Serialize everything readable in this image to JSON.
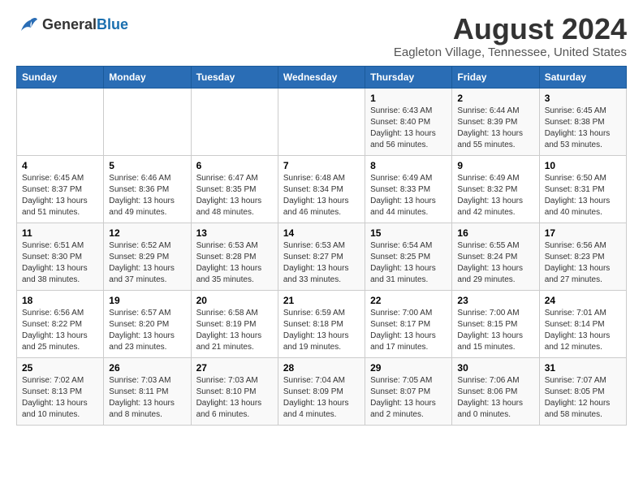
{
  "logo": {
    "general": "General",
    "blue": "Blue"
  },
  "title": "August 2024",
  "subtitle": "Eagleton Village, Tennessee, United States",
  "days_of_week": [
    "Sunday",
    "Monday",
    "Tuesday",
    "Wednesday",
    "Thursday",
    "Friday",
    "Saturday"
  ],
  "weeks": [
    [
      {
        "day": "",
        "sunrise": "",
        "sunset": "",
        "daylight": ""
      },
      {
        "day": "",
        "sunrise": "",
        "sunset": "",
        "daylight": ""
      },
      {
        "day": "",
        "sunrise": "",
        "sunset": "",
        "daylight": ""
      },
      {
        "day": "",
        "sunrise": "",
        "sunset": "",
        "daylight": ""
      },
      {
        "day": "1",
        "sunrise": "Sunrise: 6:43 AM",
        "sunset": "Sunset: 8:40 PM",
        "daylight": "Daylight: 13 hours and 56 minutes."
      },
      {
        "day": "2",
        "sunrise": "Sunrise: 6:44 AM",
        "sunset": "Sunset: 8:39 PM",
        "daylight": "Daylight: 13 hours and 55 minutes."
      },
      {
        "day": "3",
        "sunrise": "Sunrise: 6:45 AM",
        "sunset": "Sunset: 8:38 PM",
        "daylight": "Daylight: 13 hours and 53 minutes."
      }
    ],
    [
      {
        "day": "4",
        "sunrise": "Sunrise: 6:45 AM",
        "sunset": "Sunset: 8:37 PM",
        "daylight": "Daylight: 13 hours and 51 minutes."
      },
      {
        "day": "5",
        "sunrise": "Sunrise: 6:46 AM",
        "sunset": "Sunset: 8:36 PM",
        "daylight": "Daylight: 13 hours and 49 minutes."
      },
      {
        "day": "6",
        "sunrise": "Sunrise: 6:47 AM",
        "sunset": "Sunset: 8:35 PM",
        "daylight": "Daylight: 13 hours and 48 minutes."
      },
      {
        "day": "7",
        "sunrise": "Sunrise: 6:48 AM",
        "sunset": "Sunset: 8:34 PM",
        "daylight": "Daylight: 13 hours and 46 minutes."
      },
      {
        "day": "8",
        "sunrise": "Sunrise: 6:49 AM",
        "sunset": "Sunset: 8:33 PM",
        "daylight": "Daylight: 13 hours and 44 minutes."
      },
      {
        "day": "9",
        "sunrise": "Sunrise: 6:49 AM",
        "sunset": "Sunset: 8:32 PM",
        "daylight": "Daylight: 13 hours and 42 minutes."
      },
      {
        "day": "10",
        "sunrise": "Sunrise: 6:50 AM",
        "sunset": "Sunset: 8:31 PM",
        "daylight": "Daylight: 13 hours and 40 minutes."
      }
    ],
    [
      {
        "day": "11",
        "sunrise": "Sunrise: 6:51 AM",
        "sunset": "Sunset: 8:30 PM",
        "daylight": "Daylight: 13 hours and 38 minutes."
      },
      {
        "day": "12",
        "sunrise": "Sunrise: 6:52 AM",
        "sunset": "Sunset: 8:29 PM",
        "daylight": "Daylight: 13 hours and 37 minutes."
      },
      {
        "day": "13",
        "sunrise": "Sunrise: 6:53 AM",
        "sunset": "Sunset: 8:28 PM",
        "daylight": "Daylight: 13 hours and 35 minutes."
      },
      {
        "day": "14",
        "sunrise": "Sunrise: 6:53 AM",
        "sunset": "Sunset: 8:27 PM",
        "daylight": "Daylight: 13 hours and 33 minutes."
      },
      {
        "day": "15",
        "sunrise": "Sunrise: 6:54 AM",
        "sunset": "Sunset: 8:25 PM",
        "daylight": "Daylight: 13 hours and 31 minutes."
      },
      {
        "day": "16",
        "sunrise": "Sunrise: 6:55 AM",
        "sunset": "Sunset: 8:24 PM",
        "daylight": "Daylight: 13 hours and 29 minutes."
      },
      {
        "day": "17",
        "sunrise": "Sunrise: 6:56 AM",
        "sunset": "Sunset: 8:23 PM",
        "daylight": "Daylight: 13 hours and 27 minutes."
      }
    ],
    [
      {
        "day": "18",
        "sunrise": "Sunrise: 6:56 AM",
        "sunset": "Sunset: 8:22 PM",
        "daylight": "Daylight: 13 hours and 25 minutes."
      },
      {
        "day": "19",
        "sunrise": "Sunrise: 6:57 AM",
        "sunset": "Sunset: 8:20 PM",
        "daylight": "Daylight: 13 hours and 23 minutes."
      },
      {
        "day": "20",
        "sunrise": "Sunrise: 6:58 AM",
        "sunset": "Sunset: 8:19 PM",
        "daylight": "Daylight: 13 hours and 21 minutes."
      },
      {
        "day": "21",
        "sunrise": "Sunrise: 6:59 AM",
        "sunset": "Sunset: 8:18 PM",
        "daylight": "Daylight: 13 hours and 19 minutes."
      },
      {
        "day": "22",
        "sunrise": "Sunrise: 7:00 AM",
        "sunset": "Sunset: 8:17 PM",
        "daylight": "Daylight: 13 hours and 17 minutes."
      },
      {
        "day": "23",
        "sunrise": "Sunrise: 7:00 AM",
        "sunset": "Sunset: 8:15 PM",
        "daylight": "Daylight: 13 hours and 15 minutes."
      },
      {
        "day": "24",
        "sunrise": "Sunrise: 7:01 AM",
        "sunset": "Sunset: 8:14 PM",
        "daylight": "Daylight: 13 hours and 12 minutes."
      }
    ],
    [
      {
        "day": "25",
        "sunrise": "Sunrise: 7:02 AM",
        "sunset": "Sunset: 8:13 PM",
        "daylight": "Daylight: 13 hours and 10 minutes."
      },
      {
        "day": "26",
        "sunrise": "Sunrise: 7:03 AM",
        "sunset": "Sunset: 8:11 PM",
        "daylight": "Daylight: 13 hours and 8 minutes."
      },
      {
        "day": "27",
        "sunrise": "Sunrise: 7:03 AM",
        "sunset": "Sunset: 8:10 PM",
        "daylight": "Daylight: 13 hours and 6 minutes."
      },
      {
        "day": "28",
        "sunrise": "Sunrise: 7:04 AM",
        "sunset": "Sunset: 8:09 PM",
        "daylight": "Daylight: 13 hours and 4 minutes."
      },
      {
        "day": "29",
        "sunrise": "Sunrise: 7:05 AM",
        "sunset": "Sunset: 8:07 PM",
        "daylight": "Daylight: 13 hours and 2 minutes."
      },
      {
        "day": "30",
        "sunrise": "Sunrise: 7:06 AM",
        "sunset": "Sunset: 8:06 PM",
        "daylight": "Daylight: 13 hours and 0 minutes."
      },
      {
        "day": "31",
        "sunrise": "Sunrise: 7:07 AM",
        "sunset": "Sunset: 8:05 PM",
        "daylight": "Daylight: 12 hours and 58 minutes."
      }
    ]
  ]
}
